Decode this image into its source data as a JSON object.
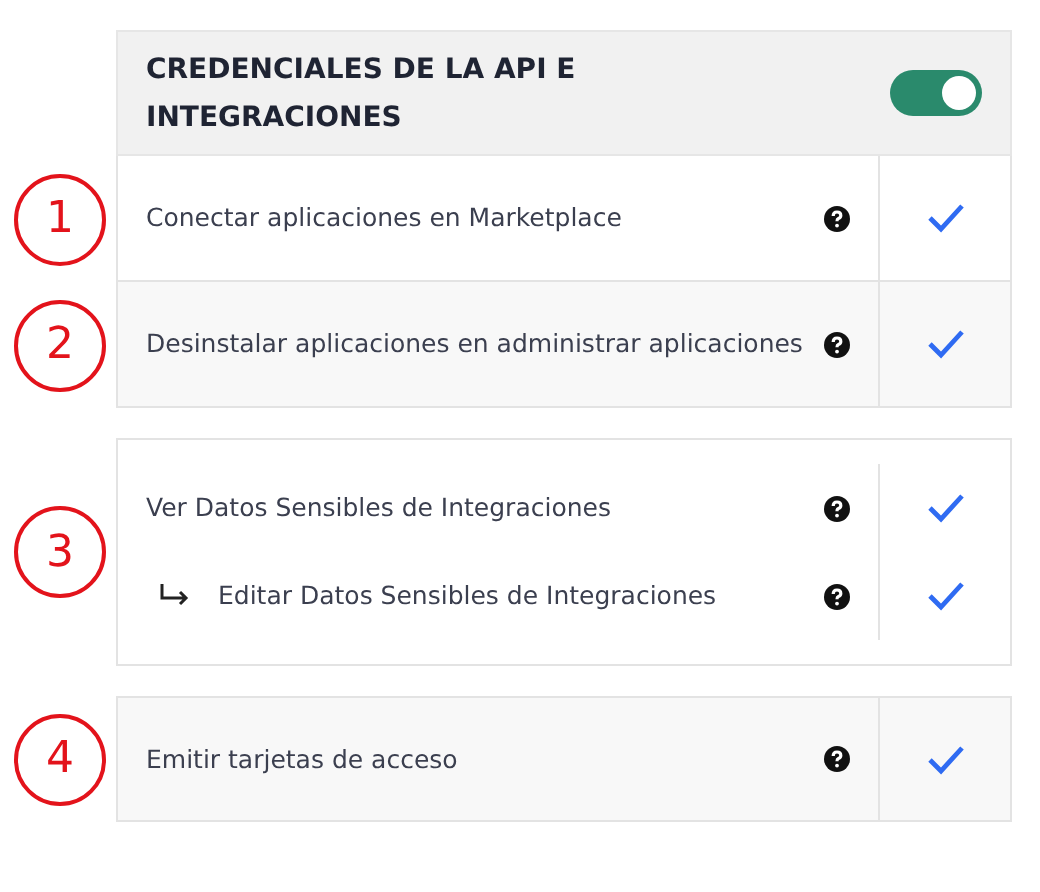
{
  "header": {
    "title": "CREDENCIALES DE LA API E INTEGRACIONES",
    "toggle_on": true
  },
  "groups": [
    {
      "marker": "1",
      "rows": [
        {
          "label": "Conectar aplicaciones en Marketplace",
          "checked": true
        }
      ]
    },
    {
      "marker": "2",
      "rows": [
        {
          "label": "Desinstalar aplicaciones en administrar aplicaciones",
          "checked": true
        }
      ]
    },
    {
      "marker": "3",
      "rows": [
        {
          "label": "Ver Datos Sensibles de Integraciones",
          "checked": true,
          "children": [
            {
              "label": "Editar Datos Sensibles de Integraciones",
              "checked": true
            }
          ]
        }
      ]
    },
    {
      "marker": "4",
      "rows": [
        {
          "label": "Emitir tarjetas de acceso",
          "checked": true
        }
      ]
    }
  ]
}
